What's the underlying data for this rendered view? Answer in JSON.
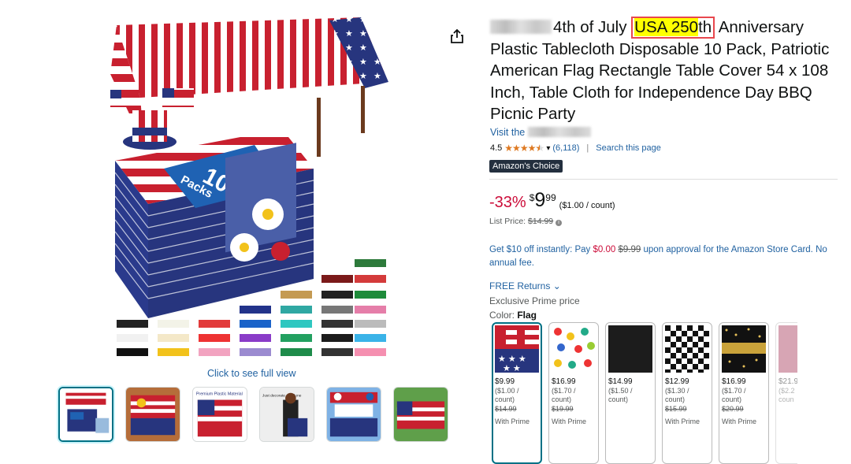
{
  "product": {
    "title_pre": "4th of July ",
    "title_highlight": "USA 250",
    "title_post_highlight": "th",
    "title_rest": " Anniversary Plastic Tablecloth Disposable 10 Pack, Patriotic American Flag Rectangle Table Cover 54 x 108 Inch, Table Cloth for Independence Day BBQ Picnic Party",
    "store_link": "Visit the",
    "rating": "4.5",
    "rating_stars": 4.5,
    "rating_count": "(6,118)",
    "search_page": "Search this page",
    "badge": "Amazon's Choice"
  },
  "gallery": {
    "see_full": "Click to see full view",
    "pack_text_number": "10",
    "pack_text_word": "Packs",
    "thumbnails": [
      {
        "name": "Main product image",
        "selected": true
      },
      {
        "name": "Table setting"
      },
      {
        "name": "Product details",
        "caption": "Premium Plastic Material"
      },
      {
        "name": "Lifestyle model",
        "caption": "Just decorate & it done"
      },
      {
        "name": "Party scene"
      },
      {
        "name": "Outdoor table"
      }
    ]
  },
  "price": {
    "discount": "-33%",
    "dollar_sign": "$",
    "whole": "9",
    "cents": "99",
    "per_unit": "($1.00 / count)",
    "list_label": "List Price: ",
    "list_value": "$14.99"
  },
  "promo": {
    "text1": "Get $10 off instantly: Pay ",
    "pay_price": "$0.00",
    "struck": "$9.99",
    "text2": " upon approval for the Amazon Store Card. No annual fee."
  },
  "shipping": {
    "returns": "FREE Returns",
    "exclusive": "Exclusive Prime price"
  },
  "color": {
    "label": "Color: ",
    "selected": "Flag",
    "swatches": [
      {
        "name": "Flag",
        "price": "$9.99",
        "unit1": "($1.00 /",
        "unit2": "count)",
        "list": "$14.99",
        "prime": "With Prime",
        "selected": true
      },
      {
        "name": "Balloons",
        "price": "$16.99",
        "unit1": "($1.70 /",
        "unit2": "count)",
        "list": "$19.99",
        "prime": "With Prime"
      },
      {
        "name": "Black",
        "price": "$14.99",
        "unit1": "($1.50 /",
        "unit2": "count)",
        "list": "",
        "prime": ""
      },
      {
        "name": "Black White Check",
        "price": "$12.99",
        "unit1": "($1.30 /",
        "unit2": "count)",
        "list": "$15.99",
        "prime": "With Prime"
      },
      {
        "name": "Black Gold",
        "price": "$16.99",
        "unit1": "($1.70 /",
        "unit2": "count)",
        "list": "$20.99",
        "prime": "With Prime"
      },
      {
        "name": "Pink",
        "price": "$21.9",
        "unit1": "($2.2",
        "unit2": "coun",
        "list": "",
        "prime": ""
      }
    ]
  },
  "colors": {
    "link": "#2162a1",
    "discount": "#cc0c39",
    "star": "#de7921",
    "badge_bg": "#232f3e",
    "highlight": "#ffff00",
    "highlight_border": "#e8474d",
    "selected_border": "#007185"
  }
}
